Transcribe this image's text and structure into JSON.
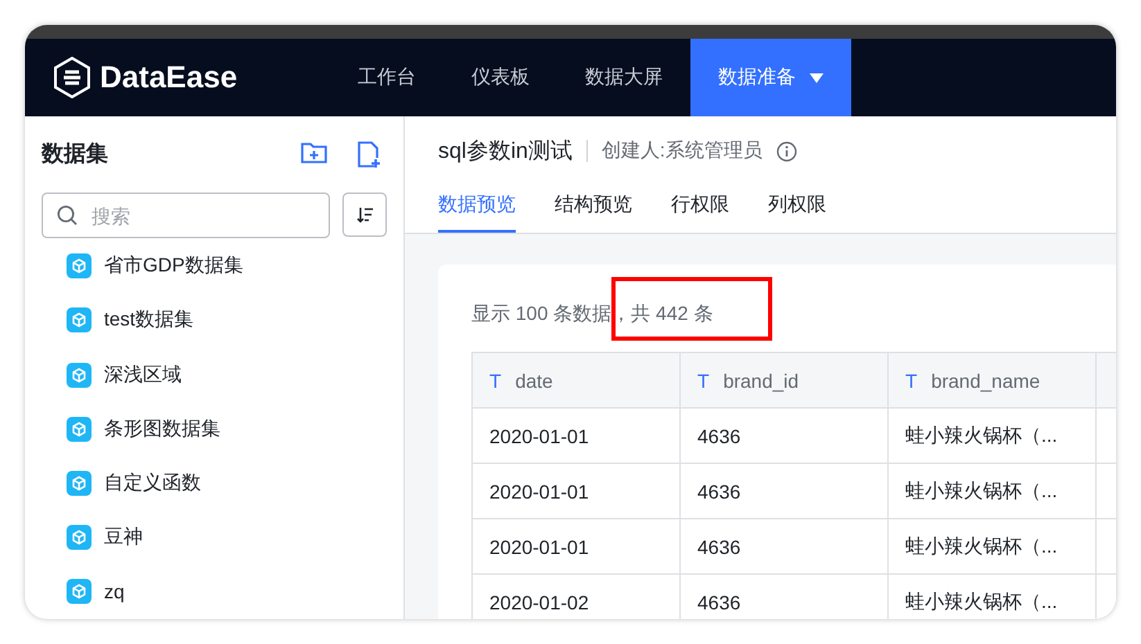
{
  "nav": {
    "logo": "DataEase",
    "items": [
      {
        "label": "工作台",
        "selected": false,
        "dropdown": false
      },
      {
        "label": "仪表板",
        "selected": false,
        "dropdown": false
      },
      {
        "label": "数据大屏",
        "selected": false,
        "dropdown": false
      },
      {
        "label": "数据准备",
        "selected": true,
        "dropdown": true
      }
    ]
  },
  "sidebar": {
    "title": "数据集",
    "search": {
      "placeholder": "搜索"
    },
    "items": [
      "省市GDP数据集",
      "test数据集",
      "深浅区域",
      "条形图数据集",
      "自定义函数",
      "豆神",
      "zq"
    ]
  },
  "dataset": {
    "title": "sql参数in测试",
    "creator": "创建人:系统管理员"
  },
  "tabs": [
    {
      "label": "数据预览",
      "selected": true
    },
    {
      "label": "结构预览",
      "selected": false
    },
    {
      "label": "行权限",
      "selected": false
    },
    {
      "label": "列权限",
      "selected": false
    }
  ],
  "summary": {
    "shown": "显示 100 条数据，",
    "total": "共 442 条",
    "highlighted": true
  },
  "table": {
    "columns": [
      {
        "type_icon": "T",
        "name": "date"
      },
      {
        "type_icon": "T",
        "name": "brand_id"
      },
      {
        "type_icon": "T",
        "name": "brand_name"
      }
    ],
    "rows": [
      [
        "2020-01-01",
        "4636",
        "蛙小辣火锅杯（..."
      ],
      [
        "2020-01-01",
        "4636",
        "蛙小辣火锅杯（..."
      ],
      [
        "2020-01-01",
        "4636",
        "蛙小辣火锅杯（..."
      ],
      [
        "2020-01-02",
        "4636",
        "蛙小辣火锅杯（..."
      ]
    ]
  }
}
